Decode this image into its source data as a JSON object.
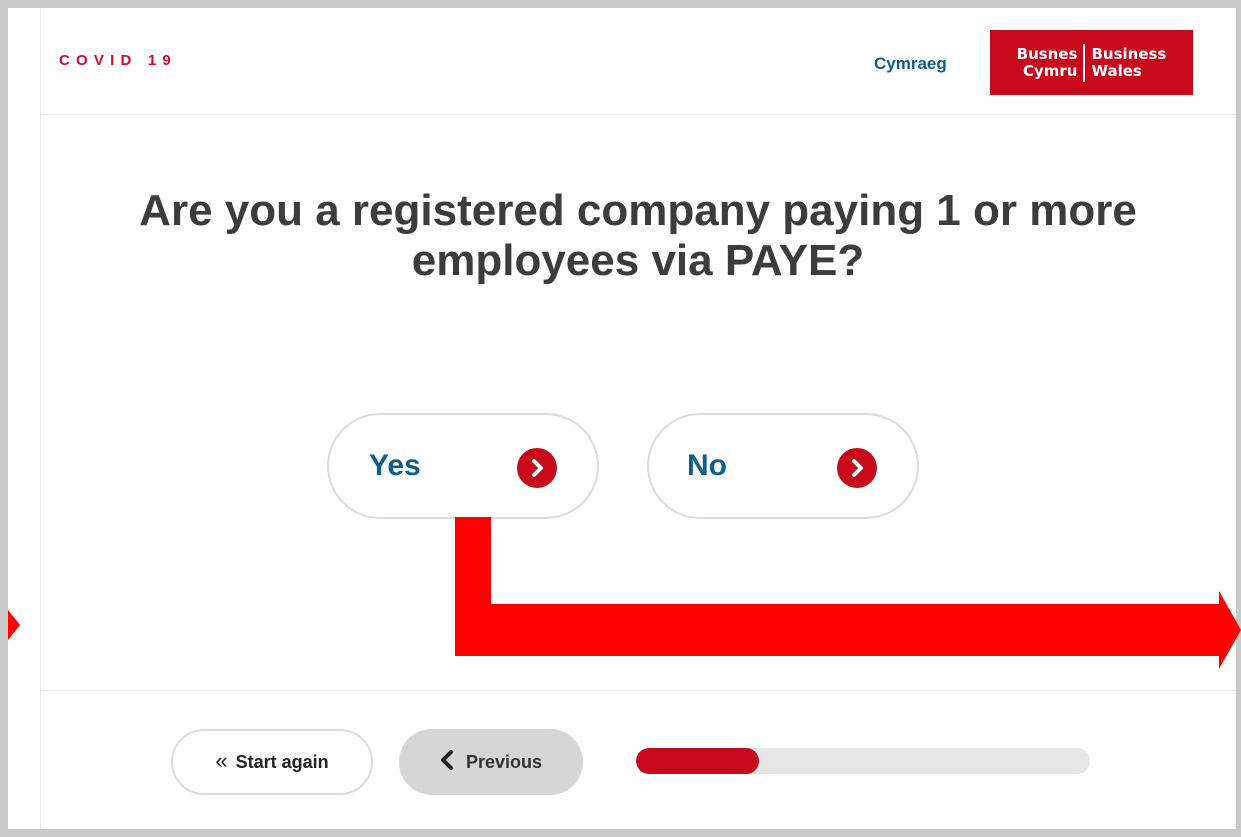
{
  "header": {
    "section_label": "COVID 19",
    "language_link": "Cymraeg",
    "logo": {
      "welsh_line1": "Busnes",
      "welsh_line2": "Cymru",
      "english_line1": "Business",
      "english_line2": "Wales"
    }
  },
  "main": {
    "question": "Are you a registered company paying 1 or more employees via PAYE?",
    "answers": [
      {
        "label": "Yes",
        "icon": "chevron-right-circle-icon"
      },
      {
        "label": "No",
        "icon": "chevron-right-circle-icon"
      }
    ]
  },
  "footer": {
    "start_again": {
      "label": "Start again",
      "icon": "double-chevron-left-icon"
    },
    "previous": {
      "label": "Previous",
      "icon": "chevron-left-icon"
    },
    "progress_fraction": 0.27
  },
  "colors": {
    "brand_red": "#c8091b",
    "link_blue": "#0b5f8c",
    "annotation_red": "#ff0000"
  }
}
